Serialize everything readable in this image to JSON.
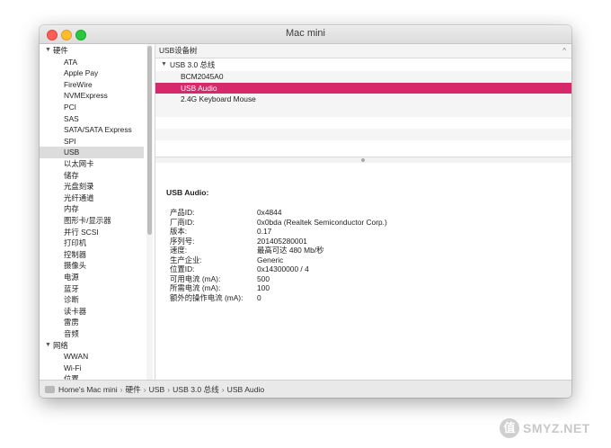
{
  "window": {
    "title": "Mac mini"
  },
  "sidebar": {
    "groups": [
      {
        "label": "硬件",
        "items": [
          "ATA",
          "Apple Pay",
          "FireWire",
          "NVMExpress",
          "PCI",
          "SAS",
          "SATA/SATA Express",
          "SPI",
          "USB",
          "以太网卡",
          "储存",
          "光盘刻录",
          "光纤通道",
          "内存",
          "图形卡/显示器",
          "并行 SCSI",
          "打印机",
          "控制器",
          "摄像头",
          "电源",
          "蓝牙",
          "诊断",
          "读卡器",
          "雷雳",
          "音频"
        ]
      },
      {
        "label": "网络",
        "items": [
          "WWAN",
          "Wi-Fi",
          "位置"
        ]
      }
    ],
    "selected": "USB"
  },
  "tree": {
    "header": "USB设备树",
    "root": "USB 3.0 总线",
    "children": [
      "BCM2045A0",
      "USB Audio",
      "2.4G Keyboard Mouse"
    ],
    "selected": "USB Audio"
  },
  "detail": {
    "title": "USB Audio:",
    "rows": [
      {
        "k": "产品ID:",
        "v": "0x4844"
      },
      {
        "k": "厂商ID:",
        "v": "0x0bda  (Realtek Semiconductor Corp.)"
      },
      {
        "k": "版本:",
        "v": "0.17"
      },
      {
        "k": "序列号:",
        "v": "201405280001"
      },
      {
        "k": "速度:",
        "v": "最高可达 480 Mb/秒"
      },
      {
        "k": "生产企业:",
        "v": "Generic"
      },
      {
        "k": "位置ID:",
        "v": "0x14300000 / 4"
      },
      {
        "k": "可用电流 (mA):",
        "v": "500"
      },
      {
        "k": "所需电流 (mA):",
        "v": "100"
      },
      {
        "k": "额外的操作电流 (mA):",
        "v": "0"
      }
    ]
  },
  "pathbar": {
    "crumbs": [
      "Home's Mac mini",
      "硬件",
      "USB",
      "USB 3.0 总线",
      "USB Audio"
    ]
  },
  "watermark": {
    "badge": "值",
    "text": "SMYZ.NET"
  },
  "colors": {
    "selection": "#d6286a",
    "sidebar_selection": "#dcdcdc"
  }
}
